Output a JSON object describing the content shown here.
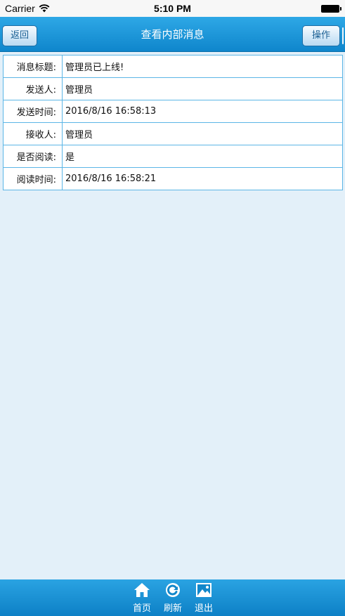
{
  "status_bar": {
    "carrier": "Carrier",
    "time": "5:10 PM"
  },
  "nav": {
    "back_label": "返回",
    "title": "查看内部消息",
    "action_label": "操作"
  },
  "message": {
    "rows": [
      {
        "label": "消息标题:",
        "value": "管理员已上线!"
      },
      {
        "label": "发送人:",
        "value": "管理员"
      },
      {
        "label": "发送时间:",
        "value": "2016/8/16 16:58:13"
      },
      {
        "label": "接收人:",
        "value": "管理员"
      },
      {
        "label": "是否阅读:",
        "value": "是"
      },
      {
        "label": "阅读时间:",
        "value": "2016/8/16 16:58:21"
      }
    ]
  },
  "tab_bar": {
    "items": [
      {
        "label": "首页",
        "icon": "home-icon"
      },
      {
        "label": "刷新",
        "icon": "refresh-icon"
      },
      {
        "label": "退出",
        "icon": "exit-image-icon"
      }
    ]
  },
  "colors": {
    "nav_top": "#2ea8e6",
    "nav_bottom": "#0f86cc",
    "background": "#e3f0f9",
    "table_border": "#5cb6e6"
  }
}
